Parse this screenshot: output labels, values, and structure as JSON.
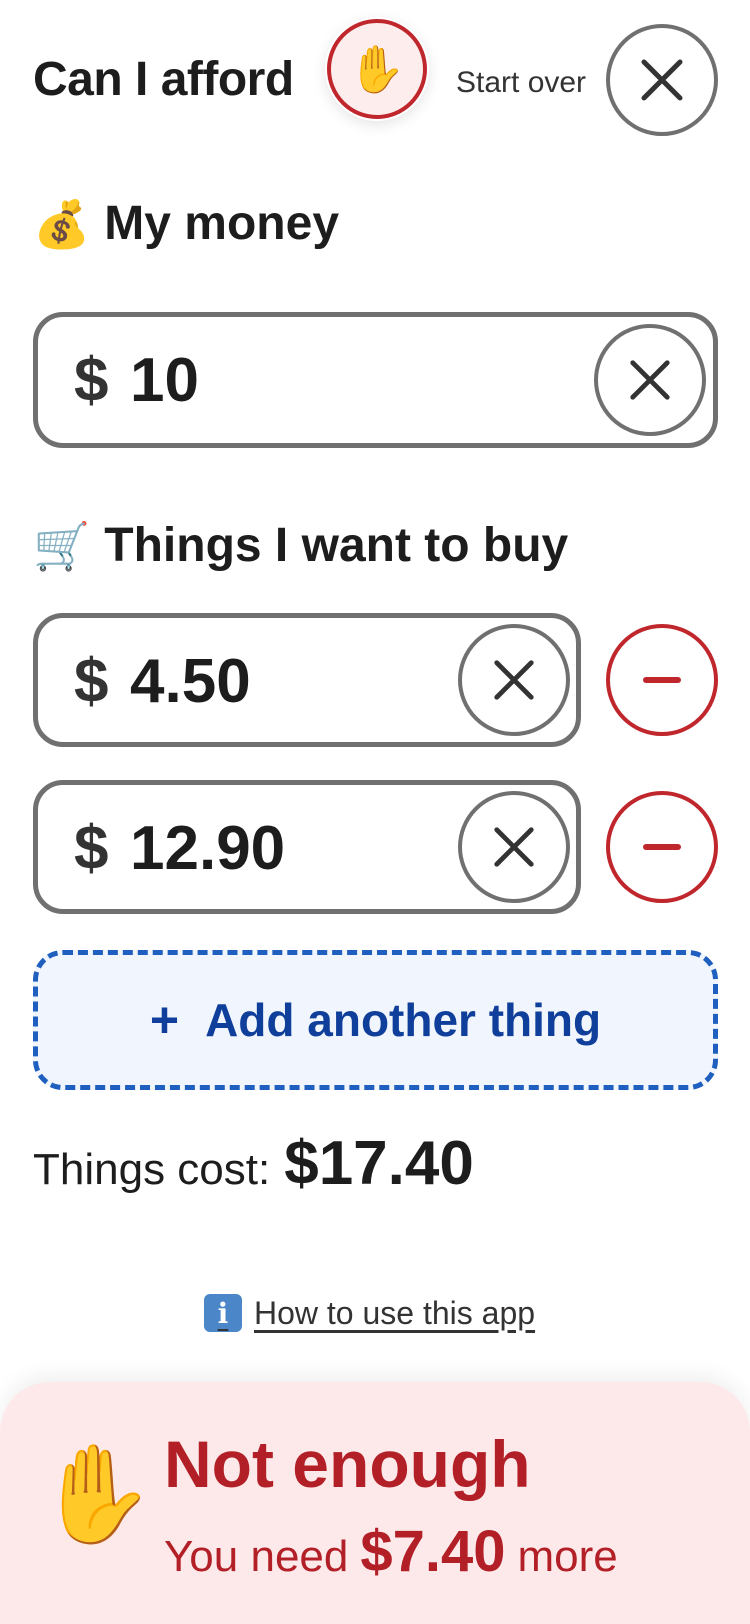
{
  "header": {
    "title": "Can I afford",
    "status_icon": "raised-hand-icon",
    "start_over_label": "Start over"
  },
  "money": {
    "heading": "My money",
    "heading_icon": "money-bag-icon",
    "currency": "$",
    "value": "10"
  },
  "things": {
    "heading": "Things I want to buy",
    "heading_icon": "shopping-cart-icon",
    "items": [
      {
        "currency": "$",
        "value": "4.50"
      },
      {
        "currency": "$",
        "value": "12.90"
      }
    ],
    "add_label": "Add another thing",
    "add_symbol": "+"
  },
  "summary": {
    "cost_label": "Things cost:",
    "cost_value": "$17.40"
  },
  "help": {
    "label": "How to use this app",
    "icon": "info-icon"
  },
  "result": {
    "title": "Not enough",
    "need_prefix": "You need",
    "need_amount": "$7.40",
    "need_suffix": "more",
    "icon": "raised-hand-icon"
  },
  "colors": {
    "accent_red": "#c0272d",
    "accent_blue": "#1f5fbf",
    "result_bg": "#fde9e9"
  }
}
